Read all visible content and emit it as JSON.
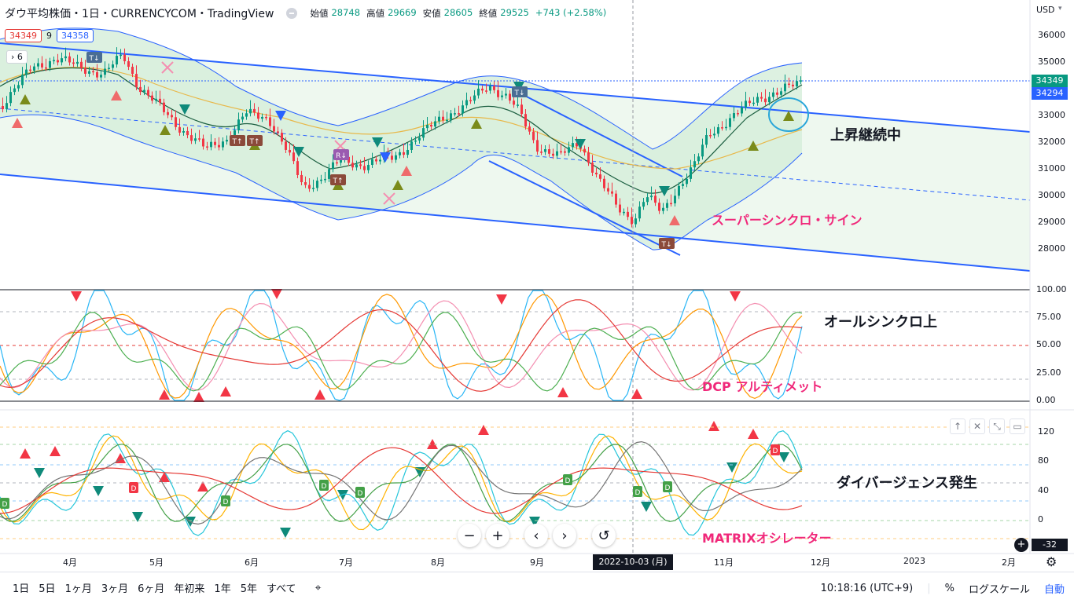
{
  "header": {
    "title": "ダウ平均株価・1日・CURRENCYCOM・TradingView",
    "ohlc": [
      {
        "label": "始値",
        "value": "28748"
      },
      {
        "label": "高値",
        "value": "29669"
      },
      {
        "label": "安値",
        "value": "28605"
      },
      {
        "label": "終値",
        "value": "29525"
      }
    ],
    "change": "+743 (+2.58%)"
  },
  "indicators": {
    "box1": "34349",
    "plain": "9",
    "box2": "34358",
    "collapse": "6"
  },
  "price_axis": {
    "currency": "USD",
    "ticks": [
      "36000",
      "35000",
      "34000",
      "33000",
      "32000",
      "31000",
      "30000",
      "29000",
      "28000"
    ],
    "last_price": "34349",
    "ma_price": "34294"
  },
  "osc1_axis": {
    "ticks": [
      "100.00",
      "75.00",
      "50.00",
      "25.00",
      "0.00"
    ]
  },
  "osc2_axis": {
    "ticks": [
      "120",
      "80",
      "40",
      "0"
    ],
    "current": "-32"
  },
  "time_axis": {
    "labels": [
      "4月",
      "5月",
      "6月",
      "7月",
      "8月",
      "9月",
      "11月",
      "12月",
      "2023",
      "2月"
    ],
    "crosshair_label": "2022-10-03 (月)"
  },
  "annotations": {
    "uptrend": "上昇継続中",
    "super_sync": "スーパーシンクロ・サイン",
    "all_sync": "オールシンクロ上",
    "dcp": "DCP アルティメット",
    "divergence": "ダイバージェンス発生",
    "matrix": "MATRIXオシレーター"
  },
  "markers": {
    "t_down": "T↓",
    "t_up": "T↑",
    "r_down": "R↓",
    "d": "D"
  },
  "ranges": [
    "1日",
    "5日",
    "1ヶ月",
    "3ヶ月",
    "6ヶ月",
    "年初来",
    "1年",
    "5年",
    "すべて"
  ],
  "footer": {
    "time": "10:18:16 (UTC+9)",
    "percent": "%",
    "log": "ログスケール",
    "auto": "自動"
  },
  "colors": {
    "up": "#089981",
    "down": "#f23645",
    "channel": "#2962ff",
    "annotation_pink": "#f0287a"
  }
}
